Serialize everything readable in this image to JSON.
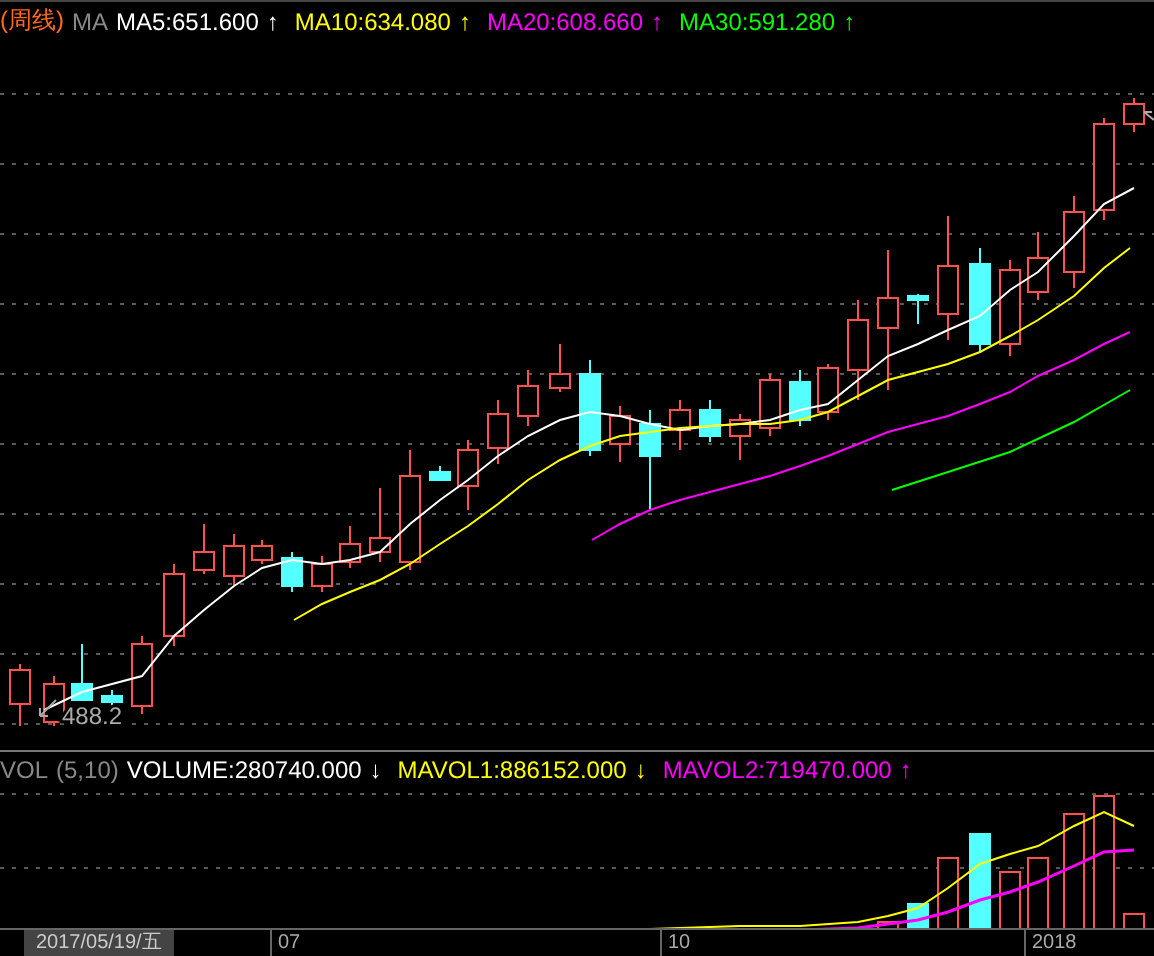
{
  "price_legend": {
    "period": "(周线)",
    "indicator": "MA",
    "items": [
      {
        "text": "MA5:651.600",
        "arrow": "↑",
        "color": "#ffffff"
      },
      {
        "text": "MA10:634.080",
        "arrow": "↑",
        "color": "#ffff00"
      },
      {
        "text": "MA20:608.660",
        "arrow": "↑",
        "color": "#ff00ff"
      },
      {
        "text": "MA30:591.280",
        "arrow": "↑",
        "color": "#00ff00"
      }
    ]
  },
  "low_label": "488.2",
  "volume_legend": {
    "indicator": "VOL",
    "params": "(5,10)",
    "items": [
      {
        "text": "VOLUME:280740.000",
        "arrow": "↓",
        "color": "#ffffff"
      },
      {
        "text": "MAVOL1:886152.000",
        "arrow": "↓",
        "color": "#ffff00"
      },
      {
        "text": "MAVOL2:719470.000",
        "arrow": "↑",
        "color": "#ff00ff"
      }
    ]
  },
  "time_axis": {
    "cursor_date": "2017/05/19/五",
    "labels": [
      "07",
      "10",
      "2018"
    ]
  }
}
